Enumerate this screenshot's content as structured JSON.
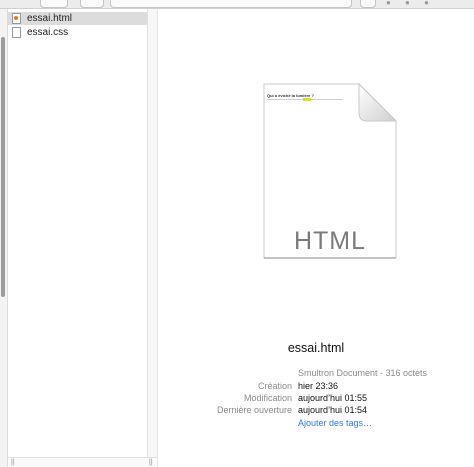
{
  "files": [
    {
      "label": "essai.html",
      "icon": "html-file-icon",
      "selected": true
    },
    {
      "label": "essai.css",
      "icon": "css-file-icon",
      "selected": false
    }
  ],
  "preview": {
    "icon_type_label": "HTML",
    "thumbnail_title": "Qui a éviché la lumière ?",
    "file_name": "essai.html",
    "kind": "Smultron Document - 316 octets",
    "details": [
      {
        "key": "Création",
        "value": "hier 23:36"
      },
      {
        "key": "Modification",
        "value": "aujourd’hui 01:55"
      },
      {
        "key": "Dernière ouverture",
        "value": "aujourd’hui 01:54"
      }
    ],
    "tags_link": "Ajouter des tags…"
  },
  "colors": {
    "link": "#2f7be0",
    "selection": "#dcdcdc",
    "secondary_text": "#8a8a8a",
    "html_highlight": "#d6e21a"
  }
}
